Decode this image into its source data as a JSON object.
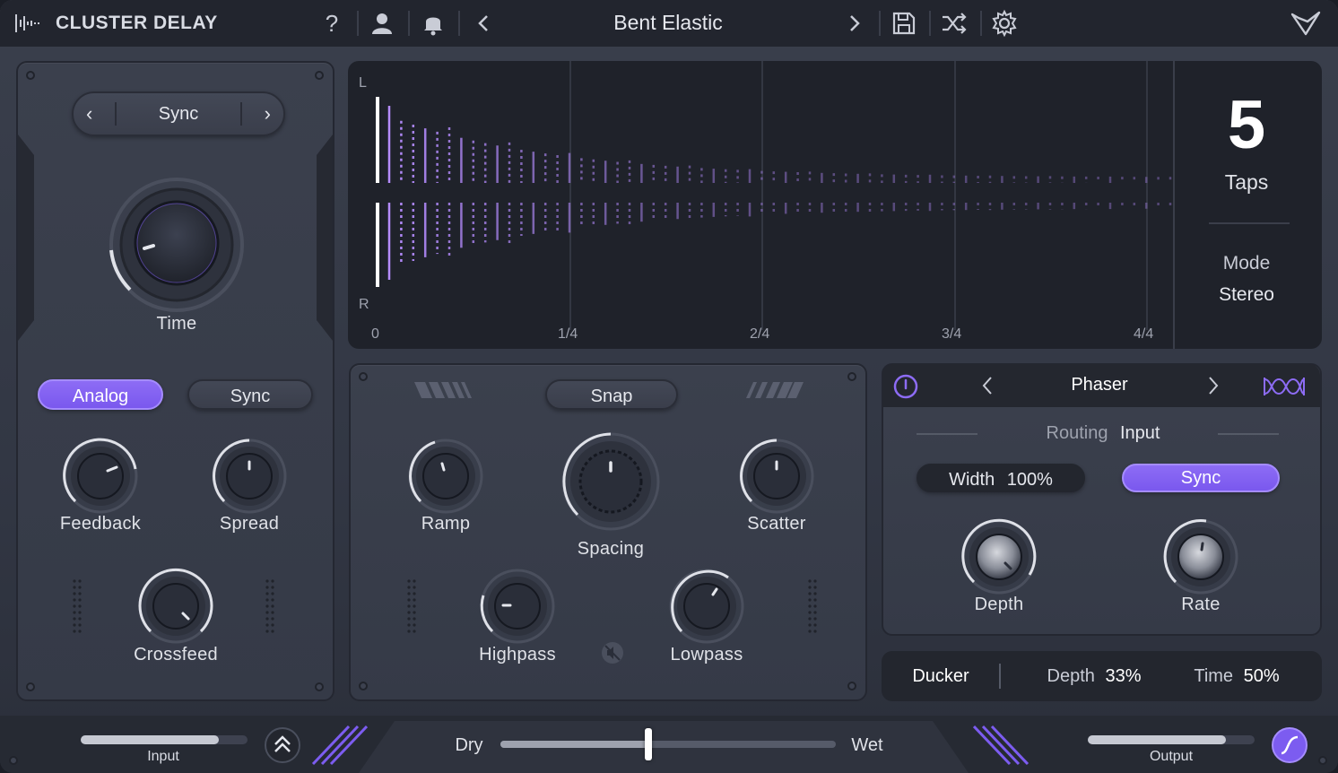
{
  "header": {
    "product_name": "CLUSTER DELAY",
    "preset_name": "Bent Elastic",
    "icons": [
      "help-icon",
      "user-icon",
      "bell-icon",
      "chevron-left-icon",
      "chevron-right-icon",
      "save-icon",
      "shuffle-icon",
      "gear-icon",
      "brand-logo-icon"
    ]
  },
  "time_panel": {
    "mode_label": "Sync",
    "time_label": "Time",
    "analog_label": "Analog",
    "sync_label": "Sync",
    "feedback_label": "Feedback",
    "spread_label": "Spread",
    "crossfeed_label": "Crossfeed"
  },
  "visualizer": {
    "channel_left": "L",
    "channel_right": "R",
    "ticks": [
      "0",
      "1/4",
      "2/4",
      "3/4",
      "4/4"
    ],
    "taps_count": "5",
    "taps_label": "Taps",
    "mode_label": "Mode",
    "mode_value": "Stereo",
    "accent_color": "#b58cff"
  },
  "cluster_panel": {
    "snap_label": "Snap",
    "ramp_label": "Ramp",
    "spacing_label": "Spacing",
    "scatter_label": "Scatter",
    "highpass_label": "Highpass",
    "lowpass_label": "Lowpass"
  },
  "fx_module": {
    "name": "Phaser",
    "routing_label": "Routing",
    "routing_value": "Input",
    "width_label": "Width",
    "width_value": "100%",
    "sync_label": "Sync",
    "depth_label": "Depth",
    "rate_label": "Rate"
  },
  "ducker": {
    "title": "Ducker",
    "depth_label": "Depth",
    "depth_value": "33%",
    "time_label": "Time",
    "time_value": "50%"
  },
  "footer": {
    "input_label": "Input",
    "output_label": "Output",
    "dry_label": "Dry",
    "wet_label": "Wet",
    "dry_wet_mix": 0.44,
    "input_level": 0.83,
    "output_level": 0.83
  },
  "colors": {
    "accent": "#7c5cf0",
    "panel": "#373c49",
    "background": "#22252e"
  }
}
